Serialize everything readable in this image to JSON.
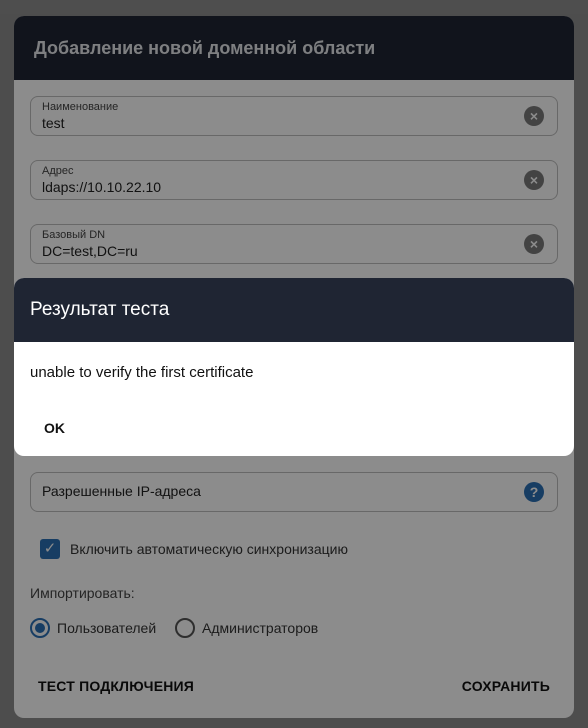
{
  "main_dialog": {
    "title": "Добавление новой доменной области",
    "fields": [
      {
        "label": "Наименование",
        "value": "test"
      },
      {
        "label": "Адрес",
        "value": "ldaps://10.10.22.10"
      },
      {
        "label": "Базовый DN",
        "value": "DC=test,DC=ru"
      }
    ],
    "allowed_ips_placeholder": "Разрешенные IP-адреса",
    "auto_sync": {
      "label": "Включить автоматическую синхронизацию",
      "checked": true
    },
    "import": {
      "label": "Импортировать:",
      "options": [
        {
          "label": "Пользователей",
          "selected": true
        },
        {
          "label": "Администраторов",
          "selected": false
        }
      ]
    },
    "test_button": "ТЕСТ ПОДКЛЮЧЕНИЯ",
    "save_button": "СОХРАНИТЬ"
  },
  "test_result_dialog": {
    "title": "Результат теста",
    "message": "unable to verify the first certificate",
    "ok_button": "OK"
  },
  "icons": {
    "clear": "x-circle-icon",
    "help": "question-circle-icon",
    "check": "checkmark-icon"
  },
  "colors": {
    "header_bg": "#1f2533",
    "accent": "#2a6fb5"
  }
}
